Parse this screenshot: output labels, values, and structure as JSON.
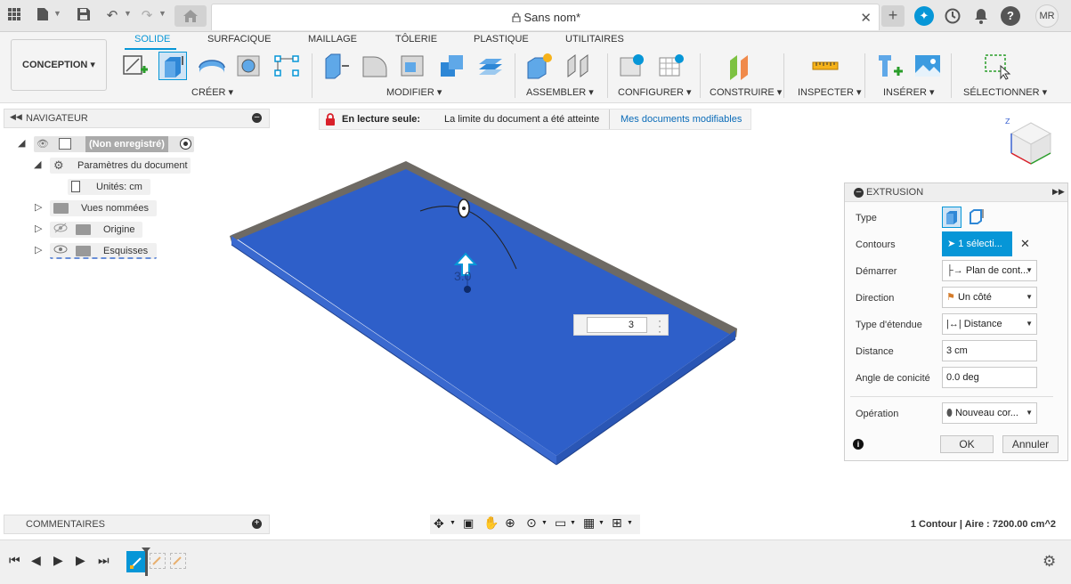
{
  "window": {
    "doc_title": "Sans nom*",
    "avatar_initials": "MR"
  },
  "ribbon": {
    "workspace": "CONCEPTION ▾",
    "tabs": [
      "SOLIDE",
      "SURFACIQUE",
      "MAILLAGE",
      "TÔLERIE",
      "PLASTIQUE",
      "UTILITAIRES"
    ],
    "groups": [
      "CRÉER ▾",
      "MODIFIER ▾",
      "ASSEMBLER ▾",
      "CONFIGURER ▾",
      "CONSTRUIRE ▾",
      "INSPECTER ▾",
      "INSÉRER ▾",
      "SÉLECTIONNER ▾"
    ]
  },
  "navigator": {
    "title": "NAVIGATEUR",
    "root": "(Non enregistré)",
    "doc_params": "Paramètres du document",
    "units": "Unités: cm",
    "named_views": "Vues nommées",
    "origin": "Origine",
    "sketches": "Esquisses"
  },
  "banner": {
    "readonly_label": "En lecture seule:",
    "message": "La limite du document a été atteinte",
    "link": "Mes documents modifiables"
  },
  "viewport": {
    "manipulator_value": "3.0",
    "input_value": "3"
  },
  "extrusion": {
    "title": "EXTRUSION",
    "labels": {
      "type": "Type",
      "contours": "Contours",
      "start": "Démarrer",
      "direction": "Direction",
      "extent_type": "Type d'étendue",
      "distance": "Distance",
      "taper": "Angle de conicité",
      "operation": "Opération"
    },
    "values": {
      "contours": "1 sélecti...",
      "start": "Plan de cont...",
      "direction": "Un côté",
      "extent_type": "Distance",
      "distance": "3 cm",
      "taper": "0.0 deg",
      "operation": "Nouveau cor..."
    },
    "ok": "OK",
    "cancel": "Annuler"
  },
  "comments": {
    "title": "COMMENTAIRES"
  },
  "status": {
    "text": "1 Contour | Aire : 7200.00 cm^2"
  },
  "colors": {
    "accent": "#0696d7",
    "body_blue": "#2e5fc9",
    "readonly_red": "#d9202a"
  }
}
